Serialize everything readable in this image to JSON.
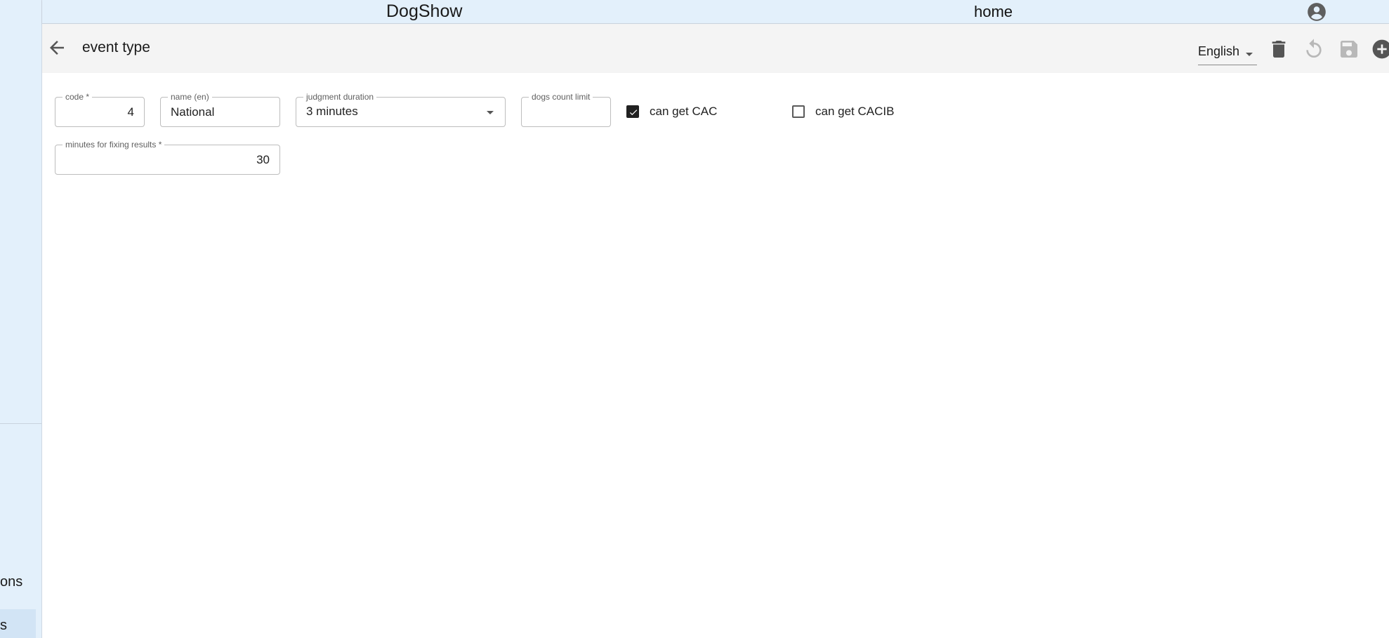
{
  "appbar": {
    "brand": "DogShow",
    "home_label": "home",
    "account_icon": "account-circle-icon"
  },
  "sidebar": {
    "partial_item_1": "ons",
    "partial_item_2": "s"
  },
  "toolbar": {
    "back_icon": "arrow-left-icon",
    "title": "event type",
    "language": "English",
    "delete_icon": "trash-icon",
    "undo_icon": "undo-icon",
    "save_icon": "save-icon",
    "add_icon": "add-circle-icon"
  },
  "form": {
    "code": {
      "label": "code *",
      "value": "4"
    },
    "name": {
      "label": "name (en)",
      "value": "National"
    },
    "judgment_duration": {
      "label": "judgment duration",
      "value": "3 minutes"
    },
    "dogs_count_limit": {
      "label": "dogs count limit",
      "value": ""
    },
    "can_get_cac": {
      "label": "can get CAC",
      "checked": true
    },
    "can_get_cacib": {
      "label": "can get CACIB",
      "checked": false
    },
    "minutes_fixing": {
      "label": "minutes for fixing results *",
      "value": "30"
    }
  },
  "colors": {
    "appbar_bg": "#e3f0fb",
    "toolbar_bg": "#f4f4f4",
    "checkbox_checked": "#212121"
  }
}
